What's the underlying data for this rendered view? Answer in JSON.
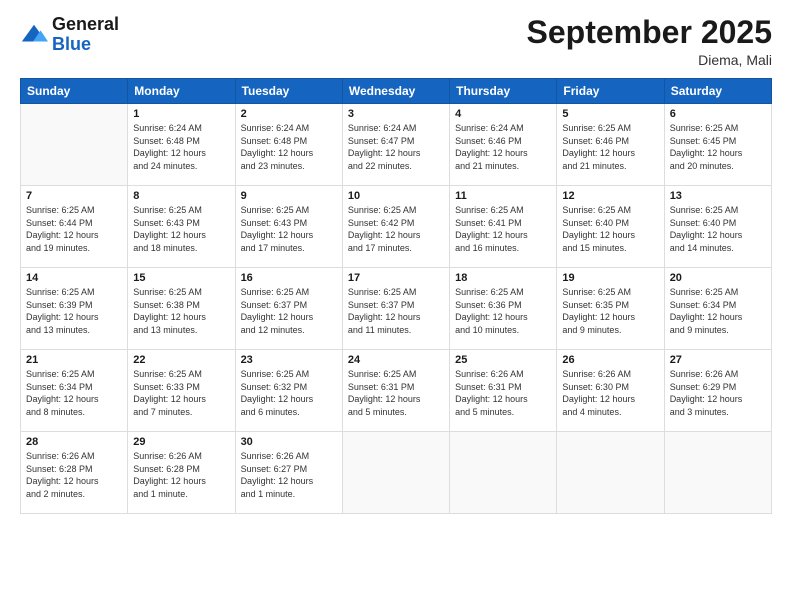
{
  "header": {
    "logo_line1": "General",
    "logo_line2": "Blue",
    "title": "September 2025",
    "location": "Diema, Mali"
  },
  "days": [
    "Sunday",
    "Monday",
    "Tuesday",
    "Wednesday",
    "Thursday",
    "Friday",
    "Saturday"
  ],
  "weeks": [
    [
      {
        "day": "",
        "info": ""
      },
      {
        "day": "1",
        "info": "Sunrise: 6:24 AM\nSunset: 6:48 PM\nDaylight: 12 hours\nand 24 minutes."
      },
      {
        "day": "2",
        "info": "Sunrise: 6:24 AM\nSunset: 6:48 PM\nDaylight: 12 hours\nand 23 minutes."
      },
      {
        "day": "3",
        "info": "Sunrise: 6:24 AM\nSunset: 6:47 PM\nDaylight: 12 hours\nand 22 minutes."
      },
      {
        "day": "4",
        "info": "Sunrise: 6:24 AM\nSunset: 6:46 PM\nDaylight: 12 hours\nand 21 minutes."
      },
      {
        "day": "5",
        "info": "Sunrise: 6:25 AM\nSunset: 6:46 PM\nDaylight: 12 hours\nand 21 minutes."
      },
      {
        "day": "6",
        "info": "Sunrise: 6:25 AM\nSunset: 6:45 PM\nDaylight: 12 hours\nand 20 minutes."
      }
    ],
    [
      {
        "day": "7",
        "info": "Sunrise: 6:25 AM\nSunset: 6:44 PM\nDaylight: 12 hours\nand 19 minutes."
      },
      {
        "day": "8",
        "info": "Sunrise: 6:25 AM\nSunset: 6:43 PM\nDaylight: 12 hours\nand 18 minutes."
      },
      {
        "day": "9",
        "info": "Sunrise: 6:25 AM\nSunset: 6:43 PM\nDaylight: 12 hours\nand 17 minutes."
      },
      {
        "day": "10",
        "info": "Sunrise: 6:25 AM\nSunset: 6:42 PM\nDaylight: 12 hours\nand 17 minutes."
      },
      {
        "day": "11",
        "info": "Sunrise: 6:25 AM\nSunset: 6:41 PM\nDaylight: 12 hours\nand 16 minutes."
      },
      {
        "day": "12",
        "info": "Sunrise: 6:25 AM\nSunset: 6:40 PM\nDaylight: 12 hours\nand 15 minutes."
      },
      {
        "day": "13",
        "info": "Sunrise: 6:25 AM\nSunset: 6:40 PM\nDaylight: 12 hours\nand 14 minutes."
      }
    ],
    [
      {
        "day": "14",
        "info": "Sunrise: 6:25 AM\nSunset: 6:39 PM\nDaylight: 12 hours\nand 13 minutes."
      },
      {
        "day": "15",
        "info": "Sunrise: 6:25 AM\nSunset: 6:38 PM\nDaylight: 12 hours\nand 13 minutes."
      },
      {
        "day": "16",
        "info": "Sunrise: 6:25 AM\nSunset: 6:37 PM\nDaylight: 12 hours\nand 12 minutes."
      },
      {
        "day": "17",
        "info": "Sunrise: 6:25 AM\nSunset: 6:37 PM\nDaylight: 12 hours\nand 11 minutes."
      },
      {
        "day": "18",
        "info": "Sunrise: 6:25 AM\nSunset: 6:36 PM\nDaylight: 12 hours\nand 10 minutes."
      },
      {
        "day": "19",
        "info": "Sunrise: 6:25 AM\nSunset: 6:35 PM\nDaylight: 12 hours\nand 9 minutes."
      },
      {
        "day": "20",
        "info": "Sunrise: 6:25 AM\nSunset: 6:34 PM\nDaylight: 12 hours\nand 9 minutes."
      }
    ],
    [
      {
        "day": "21",
        "info": "Sunrise: 6:25 AM\nSunset: 6:34 PM\nDaylight: 12 hours\nand 8 minutes."
      },
      {
        "day": "22",
        "info": "Sunrise: 6:25 AM\nSunset: 6:33 PM\nDaylight: 12 hours\nand 7 minutes."
      },
      {
        "day": "23",
        "info": "Sunrise: 6:25 AM\nSunset: 6:32 PM\nDaylight: 12 hours\nand 6 minutes."
      },
      {
        "day": "24",
        "info": "Sunrise: 6:25 AM\nSunset: 6:31 PM\nDaylight: 12 hours\nand 5 minutes."
      },
      {
        "day": "25",
        "info": "Sunrise: 6:26 AM\nSunset: 6:31 PM\nDaylight: 12 hours\nand 5 minutes."
      },
      {
        "day": "26",
        "info": "Sunrise: 6:26 AM\nSunset: 6:30 PM\nDaylight: 12 hours\nand 4 minutes."
      },
      {
        "day": "27",
        "info": "Sunrise: 6:26 AM\nSunset: 6:29 PM\nDaylight: 12 hours\nand 3 minutes."
      }
    ],
    [
      {
        "day": "28",
        "info": "Sunrise: 6:26 AM\nSunset: 6:28 PM\nDaylight: 12 hours\nand 2 minutes."
      },
      {
        "day": "29",
        "info": "Sunrise: 6:26 AM\nSunset: 6:28 PM\nDaylight: 12 hours\nand 1 minute."
      },
      {
        "day": "30",
        "info": "Sunrise: 6:26 AM\nSunset: 6:27 PM\nDaylight: 12 hours\nand 1 minute."
      },
      {
        "day": "",
        "info": ""
      },
      {
        "day": "",
        "info": ""
      },
      {
        "day": "",
        "info": ""
      },
      {
        "day": "",
        "info": ""
      }
    ]
  ]
}
